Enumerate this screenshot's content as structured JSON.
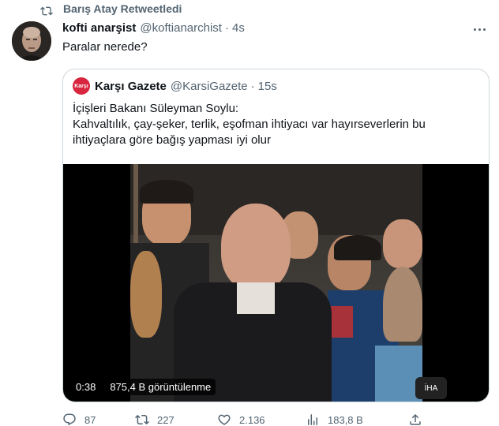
{
  "retweet": {
    "label": "Barış Atay Retweetledi"
  },
  "tweet": {
    "display_name": "kofti anarşist",
    "handle": "@koftianarchist",
    "time": "4s",
    "text": "Paralar nerede?"
  },
  "quote": {
    "avatar_text": "Karşı",
    "display_name": "Karşı Gazete",
    "handle": "@KarsiGazete",
    "time": "15s",
    "lines": [
      "İçişleri Bakanı Süleyman Soylu:",
      "Kahvaltılık, çay-şeker, terlik, eşofman ihtiyacı var hayırseverlerin bu",
      "ihtiyaçlara göre bağış yapması iyi olur"
    ]
  },
  "video": {
    "duration": "0:38",
    "views": "875,4 B görüntülenme",
    "mic_label": "İHA"
  },
  "actions": {
    "replies": "87",
    "retweets": "227",
    "likes": "2.136",
    "views": "183,8 B"
  },
  "colors": {
    "muted": "#536471",
    "text": "#0f1419",
    "border": "#cfd9de",
    "brand_red": "#d7263d"
  },
  "icons": [
    "retweet-icon",
    "more-icon",
    "reply-icon",
    "retweet-action-icon",
    "like-icon",
    "views-icon",
    "share-icon"
  ]
}
